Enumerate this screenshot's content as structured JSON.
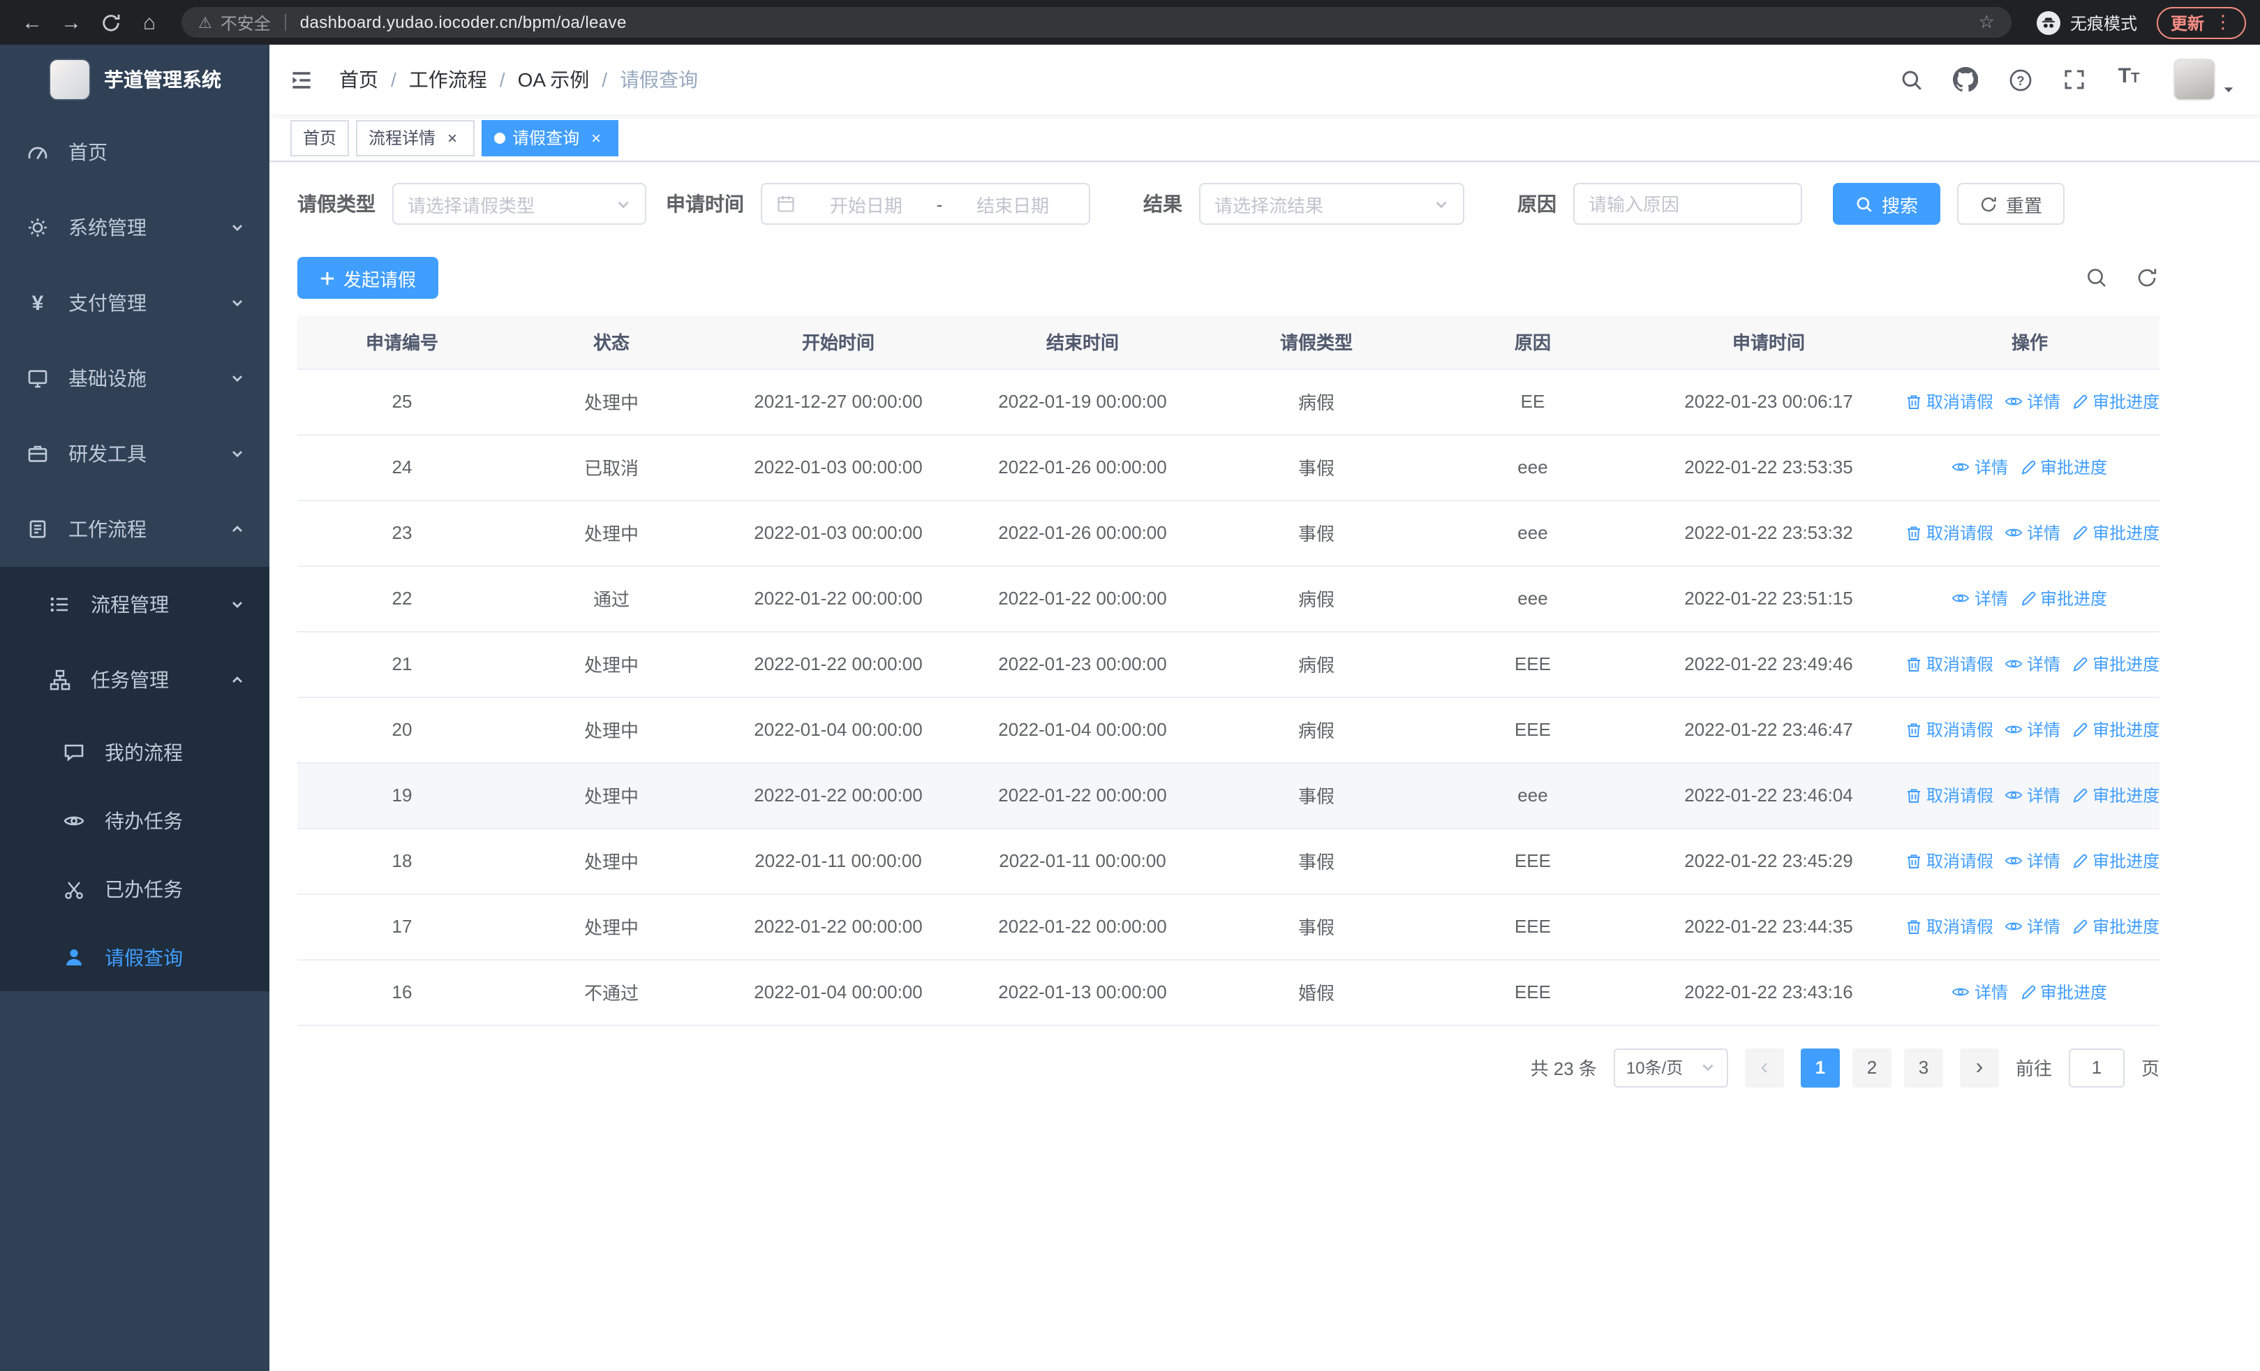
{
  "browser": {
    "security_warning": "不安全",
    "url": "dashboard.yudao.iocoder.cn/bpm/oa/leave",
    "incognito_label": "无痕模式",
    "update_label": "更新"
  },
  "sidebar": {
    "app_title": "芋道管理系统",
    "items": [
      {
        "label": "首页",
        "icon": "dashboard-icon"
      },
      {
        "label": "系统管理",
        "icon": "gear-icon"
      },
      {
        "label": "支付管理",
        "icon": "yen-icon"
      },
      {
        "label": "基础设施",
        "icon": "monitor-icon"
      },
      {
        "label": "研发工具",
        "icon": "briefcase-icon"
      },
      {
        "label": "工作流程",
        "icon": "clipboard-icon",
        "expanded": true
      }
    ],
    "sub_items": [
      {
        "label": "流程管理",
        "icon": "list-icon"
      },
      {
        "label": "任务管理",
        "icon": "org-icon",
        "expanded": true
      }
    ],
    "leaf_items": [
      {
        "label": "我的流程",
        "icon": "chat-icon"
      },
      {
        "label": "待办任务",
        "icon": "eye-icon"
      },
      {
        "label": "已办任务",
        "icon": "scissors-icon"
      },
      {
        "label": "请假查询",
        "icon": "user-icon",
        "active": true
      }
    ]
  },
  "header": {
    "breadcrumb": [
      "首页",
      "工作流程",
      "OA 示例",
      "请假查询"
    ],
    "breadcrumb_separator": "/",
    "right_icons": [
      "search-icon",
      "github-icon",
      "question-icon",
      "fullscreen-icon",
      "font-size-icon"
    ]
  },
  "tabs": [
    {
      "label": "首页",
      "closable": false,
      "active": false
    },
    {
      "label": "流程详情",
      "closable": true,
      "active": false
    },
    {
      "label": "请假查询",
      "closable": true,
      "active": true
    }
  ],
  "filters": {
    "leave_type_label": "请假类型",
    "leave_type_placeholder": "请选择请假类型",
    "apply_time_label": "申请时间",
    "start_date_placeholder": "开始日期",
    "range_separator": "-",
    "end_date_placeholder": "结束日期",
    "result_label": "结果",
    "result_placeholder": "请选择流结果",
    "reason_label": "原因",
    "reason_placeholder": "请输入原因",
    "search_button": "搜索",
    "reset_button": "重置"
  },
  "toolbar": {
    "create_button": "发起请假"
  },
  "table": {
    "columns": [
      "申请编号",
      "状态",
      "开始时间",
      "结束时间",
      "请假类型",
      "原因",
      "申请时间",
      "操作"
    ],
    "column_keys": [
      "id",
      "status",
      "start_time",
      "end_time",
      "leave_type",
      "reason",
      "apply_time"
    ],
    "action_defs": {
      "cancel": {
        "label": "取消请假",
        "icon": "trash-icon",
        "name": "cancel-leave-link"
      },
      "detail": {
        "label": "详情",
        "icon": "eye-icon",
        "name": "detail-link"
      },
      "progress": {
        "label": "审批进度",
        "icon": "edit-icon",
        "name": "approval-progress-link"
      }
    },
    "rows": [
      {
        "id": "25",
        "status": "处理中",
        "start_time": "2021-12-27 00:00:00",
        "end_time": "2022-01-19 00:00:00",
        "leave_type": "病假",
        "reason": "EE",
        "apply_time": "2022-01-23 00:06:17",
        "actions": [
          "cancel",
          "detail",
          "progress"
        ]
      },
      {
        "id": "24",
        "status": "已取消",
        "start_time": "2022-01-03 00:00:00",
        "end_time": "2022-01-26 00:00:00",
        "leave_type": "事假",
        "reason": "eee",
        "apply_time": "2022-01-22 23:53:35",
        "actions": [
          "detail",
          "progress"
        ]
      },
      {
        "id": "23",
        "status": "处理中",
        "start_time": "2022-01-03 00:00:00",
        "end_time": "2022-01-26 00:00:00",
        "leave_type": "事假",
        "reason": "eee",
        "apply_time": "2022-01-22 23:53:32",
        "actions": [
          "cancel",
          "detail",
          "progress"
        ]
      },
      {
        "id": "22",
        "status": "通过",
        "start_time": "2022-01-22 00:00:00",
        "end_time": "2022-01-22 00:00:00",
        "leave_type": "病假",
        "reason": "eee",
        "apply_time": "2022-01-22 23:51:15",
        "actions": [
          "detail",
          "progress"
        ]
      },
      {
        "id": "21",
        "status": "处理中",
        "start_time": "2022-01-22 00:00:00",
        "end_time": "2022-01-23 00:00:00",
        "leave_type": "病假",
        "reason": "EEE",
        "apply_time": "2022-01-22 23:49:46",
        "actions": [
          "cancel",
          "detail",
          "progress"
        ]
      },
      {
        "id": "20",
        "status": "处理中",
        "start_time": "2022-01-04 00:00:00",
        "end_time": "2022-01-04 00:00:00",
        "leave_type": "病假",
        "reason": "EEE",
        "apply_time": "2022-01-22 23:46:47",
        "actions": [
          "cancel",
          "detail",
          "progress"
        ]
      },
      {
        "id": "19",
        "status": "处理中",
        "start_time": "2022-01-22 00:00:00",
        "end_time": "2022-01-22 00:00:00",
        "leave_type": "事假",
        "reason": "eee",
        "apply_time": "2022-01-22 23:46:04",
        "actions": [
          "cancel",
          "detail",
          "progress"
        ],
        "highlighted": true
      },
      {
        "id": "18",
        "status": "处理中",
        "start_time": "2022-01-11 00:00:00",
        "end_time": "2022-01-11 00:00:00",
        "leave_type": "事假",
        "reason": "EEE",
        "apply_time": "2022-01-22 23:45:29",
        "actions": [
          "cancel",
          "detail",
          "progress"
        ]
      },
      {
        "id": "17",
        "status": "处理中",
        "start_time": "2022-01-22 00:00:00",
        "end_time": "2022-01-22 00:00:00",
        "leave_type": "事假",
        "reason": "EEE",
        "apply_time": "2022-01-22 23:44:35",
        "actions": [
          "cancel",
          "detail",
          "progress"
        ]
      },
      {
        "id": "16",
        "status": "不通过",
        "start_time": "2022-01-04 00:00:00",
        "end_time": "2022-01-13 00:00:00",
        "leave_type": "婚假",
        "reason": "EEE",
        "apply_time": "2022-01-22 23:43:16",
        "actions": [
          "detail",
          "progress"
        ]
      }
    ]
  },
  "pagination": {
    "total_text": "共 23 条",
    "page_size": "10条/页",
    "pages": [
      "1",
      "2",
      "3"
    ],
    "active_page": "1",
    "goto_label": "前往",
    "goto_value": "1",
    "goto_suffix": "页"
  },
  "colors": {
    "primary": "#409eff",
    "sidebar_bg": "#304156",
    "submenu_bg": "#1f2d3d",
    "update_badge": "#f28b82"
  }
}
